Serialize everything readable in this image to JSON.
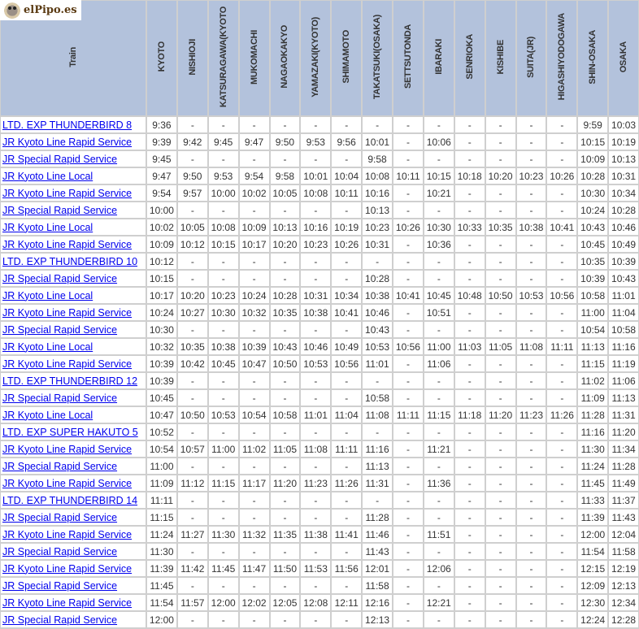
{
  "logo": {
    "text": "elPipo.es"
  },
  "header": {
    "train": "Train",
    "stations": [
      "KYOTO",
      "NISHIOJI",
      "KATSURAGAWA(KYOTO",
      "MUKOMACHI",
      "NAGAOKAKYO",
      "YAMAZAKI(KYOTO)",
      "SHIMAMOTO",
      "TAKATSUKI(OSAKA)",
      "SETTSUTONDA",
      "IBARAKI",
      "SENRIOKA",
      "KISHIBE",
      "SUITA(JR)",
      "HIGASHIYODOGAWA",
      "SHIN-OSAKA",
      "OSAKA"
    ]
  },
  "colors": {
    "header_bg": "#b3c2dc",
    "link": "#0000ee",
    "grid": "#cfcfcf"
  },
  "rows": [
    {
      "train": "LTD. EXP THUNDERBIRD 8",
      "times": [
        "9:36",
        "-",
        "-",
        "-",
        "-",
        "-",
        "-",
        "-",
        "-",
        "-",
        "-",
        "-",
        "-",
        "-",
        "9:59",
        "10:03"
      ]
    },
    {
      "train": "JR Kyoto Line Rapid Service",
      "times": [
        "9:39",
        "9:42",
        "9:45",
        "9:47",
        "9:50",
        "9:53",
        "9:56",
        "10:01",
        "-",
        "10:06",
        "-",
        "-",
        "-",
        "-",
        "10:15",
        "10:19"
      ]
    },
    {
      "train": "JR Special Rapid Service",
      "times": [
        "9:45",
        "-",
        "-",
        "-",
        "-",
        "-",
        "-",
        "9:58",
        "-",
        "-",
        "-",
        "-",
        "-",
        "-",
        "10:09",
        "10:13"
      ]
    },
    {
      "train": "JR Kyoto Line Local",
      "times": [
        "9:47",
        "9:50",
        "9:53",
        "9:54",
        "9:58",
        "10:01",
        "10:04",
        "10:08",
        "10:11",
        "10:15",
        "10:18",
        "10:20",
        "10:23",
        "10:26",
        "10:28",
        "10:31"
      ]
    },
    {
      "train": "JR Kyoto Line Rapid Service",
      "times": [
        "9:54",
        "9:57",
        "10:00",
        "10:02",
        "10:05",
        "10:08",
        "10:11",
        "10:16",
        "-",
        "10:21",
        "-",
        "-",
        "-",
        "-",
        "10:30",
        "10:34"
      ]
    },
    {
      "train": "JR Special Rapid Service",
      "times": [
        "10:00",
        "-",
        "-",
        "-",
        "-",
        "-",
        "-",
        "10:13",
        "-",
        "-",
        "-",
        "-",
        "-",
        "-",
        "10:24",
        "10:28"
      ]
    },
    {
      "train": "JR Kyoto Line Local",
      "times": [
        "10:02",
        "10:05",
        "10:08",
        "10:09",
        "10:13",
        "10:16",
        "10:19",
        "10:23",
        "10:26",
        "10:30",
        "10:33",
        "10:35",
        "10:38",
        "10:41",
        "10:43",
        "10:46"
      ]
    },
    {
      "train": "JR Kyoto Line Rapid Service",
      "times": [
        "10:09",
        "10:12",
        "10:15",
        "10:17",
        "10:20",
        "10:23",
        "10:26",
        "10:31",
        "-",
        "10:36",
        "-",
        "-",
        "-",
        "-",
        "10:45",
        "10:49"
      ]
    },
    {
      "train": "LTD. EXP THUNDERBIRD 10",
      "times": [
        "10:12",
        "-",
        "-",
        "-",
        "-",
        "-",
        "-",
        "-",
        "-",
        "-",
        "-",
        "-",
        "-",
        "-",
        "10:35",
        "10:39"
      ]
    },
    {
      "train": "JR Special Rapid Service",
      "times": [
        "10:15",
        "-",
        "-",
        "-",
        "-",
        "-",
        "-",
        "10:28",
        "-",
        "-",
        "-",
        "-",
        "-",
        "-",
        "10:39",
        "10:43"
      ]
    },
    {
      "train": "JR Kyoto Line Local",
      "times": [
        "10:17",
        "10:20",
        "10:23",
        "10:24",
        "10:28",
        "10:31",
        "10:34",
        "10:38",
        "10:41",
        "10:45",
        "10:48",
        "10:50",
        "10:53",
        "10:56",
        "10:58",
        "11:01"
      ]
    },
    {
      "train": "JR Kyoto Line Rapid Service",
      "times": [
        "10:24",
        "10:27",
        "10:30",
        "10:32",
        "10:35",
        "10:38",
        "10:41",
        "10:46",
        "-",
        "10:51",
        "-",
        "-",
        "-",
        "-",
        "11:00",
        "11:04"
      ]
    },
    {
      "train": "JR Special Rapid Service",
      "times": [
        "10:30",
        "-",
        "-",
        "-",
        "-",
        "-",
        "-",
        "10:43",
        "-",
        "-",
        "-",
        "-",
        "-",
        "-",
        "10:54",
        "10:58"
      ]
    },
    {
      "train": "JR Kyoto Line Local",
      "times": [
        "10:32",
        "10:35",
        "10:38",
        "10:39",
        "10:43",
        "10:46",
        "10:49",
        "10:53",
        "10:56",
        "11:00",
        "11:03",
        "11:05",
        "11:08",
        "11:11",
        "11:13",
        "11:16"
      ]
    },
    {
      "train": "JR Kyoto Line Rapid Service",
      "times": [
        "10:39",
        "10:42",
        "10:45",
        "10:47",
        "10:50",
        "10:53",
        "10:56",
        "11:01",
        "-",
        "11:06",
        "-",
        "-",
        "-",
        "-",
        "11:15",
        "11:19"
      ]
    },
    {
      "train": "LTD. EXP THUNDERBIRD 12",
      "times": [
        "10:39",
        "-",
        "-",
        "-",
        "-",
        "-",
        "-",
        "-",
        "-",
        "-",
        "-",
        "-",
        "-",
        "-",
        "11:02",
        "11:06"
      ]
    },
    {
      "train": "JR Special Rapid Service",
      "times": [
        "10:45",
        "-",
        "-",
        "-",
        "-",
        "-",
        "-",
        "10:58",
        "-",
        "-",
        "-",
        "-",
        "-",
        "-",
        "11:09",
        "11:13"
      ]
    },
    {
      "train": "JR Kyoto Line Local",
      "times": [
        "10:47",
        "10:50",
        "10:53",
        "10:54",
        "10:58",
        "11:01",
        "11:04",
        "11:08",
        "11:11",
        "11:15",
        "11:18",
        "11:20",
        "11:23",
        "11:26",
        "11:28",
        "11:31"
      ]
    },
    {
      "train": "LTD. EXP SUPER HAKUTO 5",
      "times": [
        "10:52",
        "-",
        "-",
        "-",
        "-",
        "-",
        "-",
        "-",
        "-",
        "-",
        "-",
        "-",
        "-",
        "-",
        "11:16",
        "11:20"
      ]
    },
    {
      "train": "JR Kyoto Line Rapid Service",
      "times": [
        "10:54",
        "10:57",
        "11:00",
        "11:02",
        "11:05",
        "11:08",
        "11:11",
        "11:16",
        "-",
        "11:21",
        "-",
        "-",
        "-",
        "-",
        "11:30",
        "11:34"
      ]
    },
    {
      "train": "JR Special Rapid Service",
      "times": [
        "11:00",
        "-",
        "-",
        "-",
        "-",
        "-",
        "-",
        "11:13",
        "-",
        "-",
        "-",
        "-",
        "-",
        "-",
        "11:24",
        "11:28"
      ]
    },
    {
      "train": "JR Kyoto Line Rapid Service",
      "times": [
        "11:09",
        "11:12",
        "11:15",
        "11:17",
        "11:20",
        "11:23",
        "11:26",
        "11:31",
        "-",
        "11:36",
        "-",
        "-",
        "-",
        "-",
        "11:45",
        "11:49"
      ]
    },
    {
      "train": "LTD. EXP THUNDERBIRD 14",
      "times": [
        "11:11",
        "-",
        "-",
        "-",
        "-",
        "-",
        "-",
        "-",
        "-",
        "-",
        "-",
        "-",
        "-",
        "-",
        "11:33",
        "11:37"
      ]
    },
    {
      "train": "JR Special Rapid Service",
      "times": [
        "11:15",
        "-",
        "-",
        "-",
        "-",
        "-",
        "-",
        "11:28",
        "-",
        "-",
        "-",
        "-",
        "-",
        "-",
        "11:39",
        "11:43"
      ]
    },
    {
      "train": "JR Kyoto Line Rapid Service",
      "times": [
        "11:24",
        "11:27",
        "11:30",
        "11:32",
        "11:35",
        "11:38",
        "11:41",
        "11:46",
        "-",
        "11:51",
        "-",
        "-",
        "-",
        "-",
        "12:00",
        "12:04"
      ]
    },
    {
      "train": "JR Special Rapid Service",
      "times": [
        "11:30",
        "-",
        "-",
        "-",
        "-",
        "-",
        "-",
        "11:43",
        "-",
        "-",
        "-",
        "-",
        "-",
        "-",
        "11:54",
        "11:58"
      ]
    },
    {
      "train": "JR Kyoto Line Rapid Service",
      "times": [
        "11:39",
        "11:42",
        "11:45",
        "11:47",
        "11:50",
        "11:53",
        "11:56",
        "12:01",
        "-",
        "12:06",
        "-",
        "-",
        "-",
        "-",
        "12:15",
        "12:19"
      ]
    },
    {
      "train": "JR Special Rapid Service",
      "times": [
        "11:45",
        "-",
        "-",
        "-",
        "-",
        "-",
        "-",
        "11:58",
        "-",
        "-",
        "-",
        "-",
        "-",
        "-",
        "12:09",
        "12:13"
      ]
    },
    {
      "train": "JR Kyoto Line Rapid Service",
      "times": [
        "11:54",
        "11:57",
        "12:00",
        "12:02",
        "12:05",
        "12:08",
        "12:11",
        "12:16",
        "-",
        "12:21",
        "-",
        "-",
        "-",
        "-",
        "12:30",
        "12:34"
      ]
    },
    {
      "train": "JR Special Rapid Service",
      "times": [
        "12:00",
        "-",
        "-",
        "-",
        "-",
        "-",
        "-",
        "12:13",
        "-",
        "-",
        "-",
        "-",
        "-",
        "-",
        "12:24",
        "12:28"
      ]
    }
  ]
}
